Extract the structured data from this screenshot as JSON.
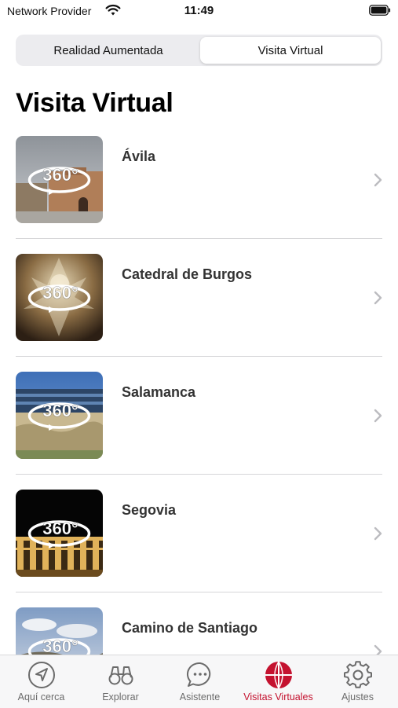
{
  "status_bar": {
    "carrier": "Network Provider",
    "time": "11:49"
  },
  "segment": {
    "options": [
      "Realidad Aumentada",
      "Visita Virtual"
    ],
    "selected": "Visita Virtual"
  },
  "title": "Visita Virtual",
  "badge_text": "360°",
  "items": [
    {
      "label": "Ávila",
      "thumb": "avila"
    },
    {
      "label": "Catedral de Burgos",
      "thumb": "burgos"
    },
    {
      "label": "Salamanca",
      "thumb": "salamanca"
    },
    {
      "label": "Segovia",
      "thumb": "segovia"
    },
    {
      "label": "Camino de Santiago",
      "thumb": "santiago"
    }
  ],
  "tabs": [
    {
      "label": "Aquí cerca",
      "icon": "location-arrow-icon"
    },
    {
      "label": "Explorar",
      "icon": "binoculars-icon"
    },
    {
      "label": "Asistente",
      "icon": "chat-bubble-icon"
    },
    {
      "label": "Visitas Virtuales",
      "icon": "globe-icon",
      "active": true
    },
    {
      "label": "Ajustes",
      "icon": "gear-icon"
    }
  ],
  "colors": {
    "accent": "#c4122f",
    "tab_inactive": "#6b6b6b",
    "segment_bg": "#ececef"
  }
}
